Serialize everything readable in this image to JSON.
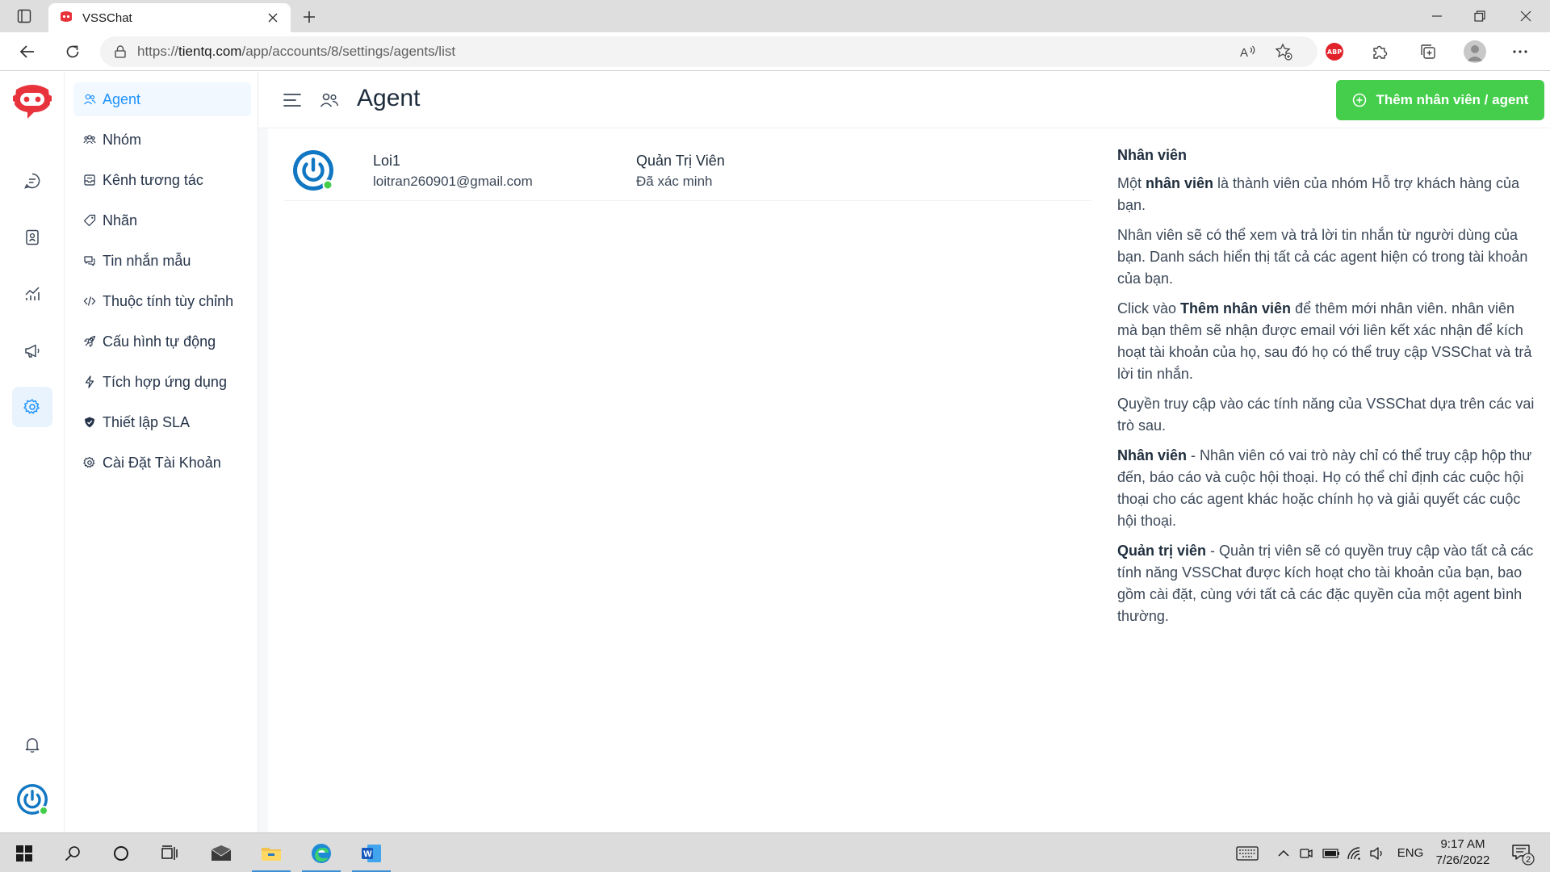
{
  "browser": {
    "tab_title": "VSSChat",
    "url_prefix": "https://",
    "url_domain": "tientq.com",
    "url_path": "/app/accounts/8/settings/agents/list"
  },
  "sidebar": {
    "items": [
      {
        "label": "Agent",
        "icon": "users-icon",
        "active": true
      },
      {
        "label": "Nhóm",
        "icon": "team-icon"
      },
      {
        "label": "Kênh tương tác",
        "icon": "inbox-icon"
      },
      {
        "label": "Nhãn",
        "icon": "tag-icon"
      },
      {
        "label": "Tin nhắn mẫu",
        "icon": "chat-template-icon"
      },
      {
        "label": "Thuộc tính tùy chỉnh",
        "icon": "code-icon"
      },
      {
        "label": "Cấu hình tự động",
        "icon": "rocket-icon"
      },
      {
        "label": "Tích hợp ứng dụng",
        "icon": "flash-icon"
      },
      {
        "label": "Thiết lập SLA",
        "icon": "shield-icon"
      },
      {
        "label": "Cài Đặt Tài Khoản",
        "icon": "gear-icon"
      }
    ]
  },
  "header": {
    "title": "Agent",
    "add_button": "Thêm nhân viên / agent"
  },
  "agents": [
    {
      "name": "Loi1",
      "email": "loitran260901@gmail.com",
      "role": "Quản Trị Viên",
      "status": "Đã xác minh"
    }
  ],
  "help": {
    "title": "Nhân viên",
    "p1_pre": "Một ",
    "p1_bold": "nhân viên",
    "p1_post": " là thành viên của nhóm Hỗ trợ khách hàng của bạn.",
    "p2": "Nhân viên sẽ có thể xem và trả lời tin nhắn từ người dùng của bạn. Danh sách hiển thị tất cả các agent hiện có trong tài khoản của bạn.",
    "p3_pre": "Click vào ",
    "p3_bold": "Thêm nhân viên",
    "p3_post": " để thêm mới nhân viên. nhân viên mà bạn thêm sẽ nhận được email với liên kết xác nhận để kích hoạt tài khoản của họ, sau đó họ có thể truy cập VSSChat và trả lời tin nhắn.",
    "p4": "Quyền truy cập vào các tính năng của VSSChat dựa trên các vai trò sau.",
    "p5_bold": "Nhân viên",
    "p5_post": " - Nhân viên có vai trò này chỉ có thể truy cập hộp thư đến, báo cáo và cuộc hội thoại. Họ có thể chỉ định các cuộc hội thoại cho các agent khác hoặc chính họ và giải quyết các cuộc hội thoại.",
    "p6_bold": "Quản trị viên",
    "p6_post": " - Quản trị viên sẽ có quyền truy cập vào tất cả các tính năng VSSChat được kích hoạt cho tài khoản của bạn, bao gồm cài đặt, cùng với tất cả các đặc quyền của một agent bình thường."
  },
  "taskbar": {
    "language": "ENG",
    "time": "9:17 AM",
    "date": "7/26/2022",
    "notifications": "2"
  },
  "colors": {
    "accent": "#1f93ff",
    "add_button": "#44ce4b",
    "online": "#44ce4b",
    "brand_red": "#e8323c"
  }
}
